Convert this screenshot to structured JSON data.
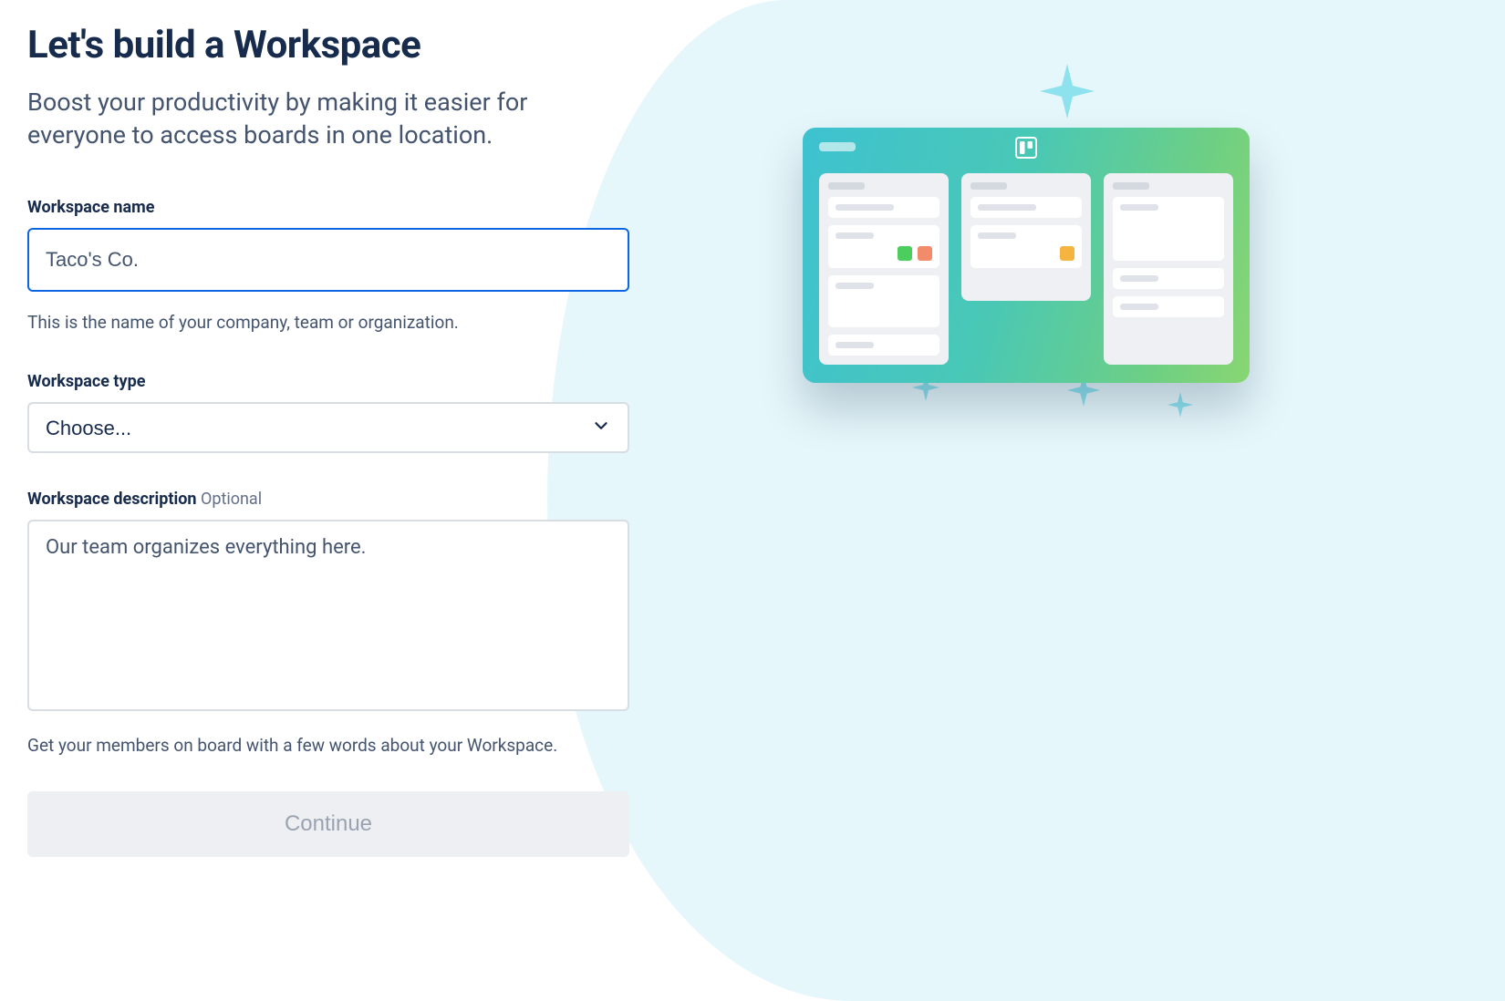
{
  "heading": "Let's build a Workspace",
  "subtitle": "Boost your productivity by making it easier for everyone to access boards in one location.",
  "fields": {
    "name": {
      "label": "Workspace name",
      "placeholder": "Taco's Co.",
      "value": "",
      "helper": "This is the name of your company, team or organization."
    },
    "type": {
      "label": "Workspace type",
      "selected": "Choose..."
    },
    "description": {
      "label": "Workspace description",
      "optional_tag": "Optional",
      "placeholder": "Our team organizes everything here.",
      "value": "",
      "helper": "Get your members on board with a few words about your Workspace."
    }
  },
  "actions": {
    "continue": "Continue"
  }
}
